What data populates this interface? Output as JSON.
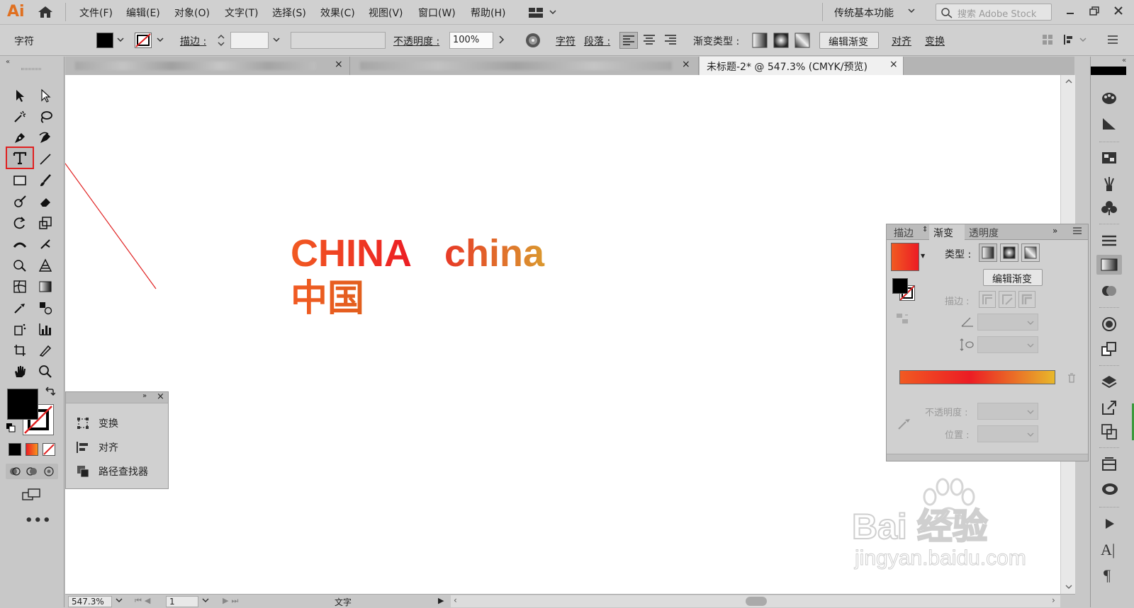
{
  "app": {
    "logo": "Ai"
  },
  "menu": [
    "文件(F)",
    "编辑(E)",
    "对象(O)",
    "文字(T)",
    "选择(S)",
    "效果(C)",
    "视图(V)",
    "窗口(W)",
    "帮助(H)"
  ],
  "workspace": "传统基本功能",
  "search": {
    "placeholder": "搜索 Adobe Stock"
  },
  "control": {
    "selection_label": "字符",
    "stroke_label": "描边 :",
    "opacity_label": "不透明度 :",
    "opacity_value": "100%",
    "char_label": "字符",
    "para_label": "段落 :",
    "gradient_type_label": "渐变类型 :",
    "edit_gradient": "编辑渐变",
    "align": "对齐",
    "transform": "变换"
  },
  "tabs": [
    {
      "label": "",
      "blurred": true
    },
    {
      "label": "",
      "blurred": true
    },
    {
      "label": "未标题-2* @ 547.3% (CMYK/预览)"
    }
  ],
  "artwork": {
    "line1_a": "CHINA",
    "line1_b": "china",
    "line2": "中国"
  },
  "gradient_panel": {
    "tabs": [
      "描边",
      "渐变",
      "透明度"
    ],
    "type_label": "类型 :",
    "edit_button": "编辑渐变",
    "stroke_label": "描边 :",
    "opacity_label": "不透明度 :",
    "location_label": "位置 :",
    "gradient_colors": [
      "#f15a22",
      "#ec1c24",
      "#e8b82a"
    ]
  },
  "mini_panel": {
    "items": [
      "变换",
      "对齐",
      "路径查找器"
    ]
  },
  "status": {
    "zoom": "547.3%",
    "page": "1",
    "tool": "文字"
  },
  "watermark": {
    "brand": "Bai 经验",
    "url": "jingyan.baidu.com"
  },
  "colors": {
    "fill": "#000000",
    "accent_red": "#e02020"
  }
}
